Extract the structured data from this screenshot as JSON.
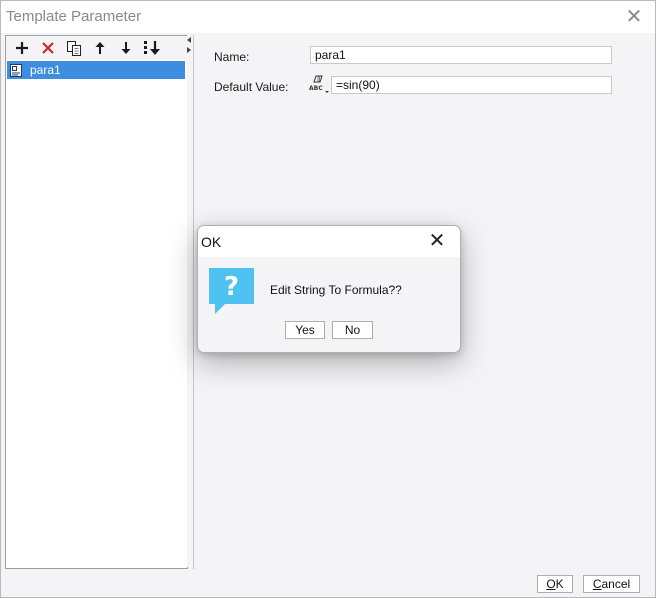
{
  "window": {
    "title": "Template Parameter"
  },
  "toolbar": {
    "icons": [
      "add-icon",
      "delete-icon",
      "copy-icon",
      "move-up-icon",
      "move-down-icon",
      "sort-down-icon"
    ],
    "colors": {
      "add": "#1a1a1a",
      "delete": "#d9262a"
    }
  },
  "tree": {
    "items": [
      {
        "label": "para1",
        "selected": true
      }
    ],
    "selection_color": "#3d8ee0"
  },
  "form": {
    "name_label": "Name:",
    "name_value": "para1",
    "default_label": "Default Value:",
    "default_icon_text": "ABC",
    "default_value": "=sin(90)"
  },
  "footer": {
    "ok_label": "OK",
    "ok_mnemonic": "O",
    "cancel_label": "Cancel",
    "cancel_mnemonic": "C"
  },
  "dialog": {
    "title": "OK",
    "message": "Edit String To Formula??",
    "icon": "question-icon",
    "icon_color": "#4fc1f0",
    "yes_label": "Yes",
    "no_label": "No"
  }
}
